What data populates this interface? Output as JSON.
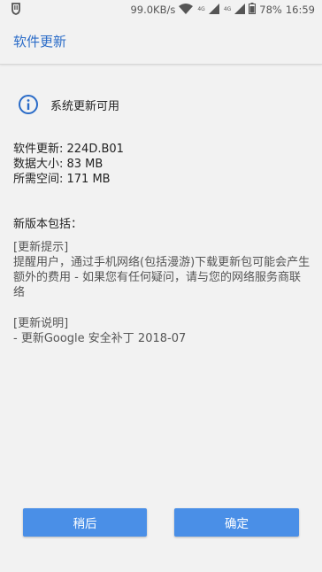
{
  "status_bar": {
    "left_icon": "shield-icon",
    "speed": "99.0KB/s",
    "net1": "4G",
    "net2": "4G",
    "battery": "78%",
    "time": "16:59"
  },
  "app_bar": {
    "title": "软件更新"
  },
  "content": {
    "available_text": "系统更新可用",
    "software_update": "软件更新: 224D.B01",
    "data_size": "数据大小: 83 MB",
    "space_needed": "所需空间: 171 MB",
    "new_version_includes": "新版本包括：",
    "update_tip_header": "[更新提示]",
    "update_tip_body": "提醒用户，通过手机网络(包括漫游)下载更新包可能会产生额外的费用 - 如果您有任何疑问，请与您的网络服务商联络",
    "update_notes_header": "[更新说明]",
    "update_notes_body": "- 更新Google 安全补丁 2018-07"
  },
  "buttons": {
    "later": "稍后",
    "ok": "确定"
  },
  "colors": {
    "accent": "#2b6cc8",
    "button": "#4a8fe7",
    "background": "#f2f2f2"
  }
}
